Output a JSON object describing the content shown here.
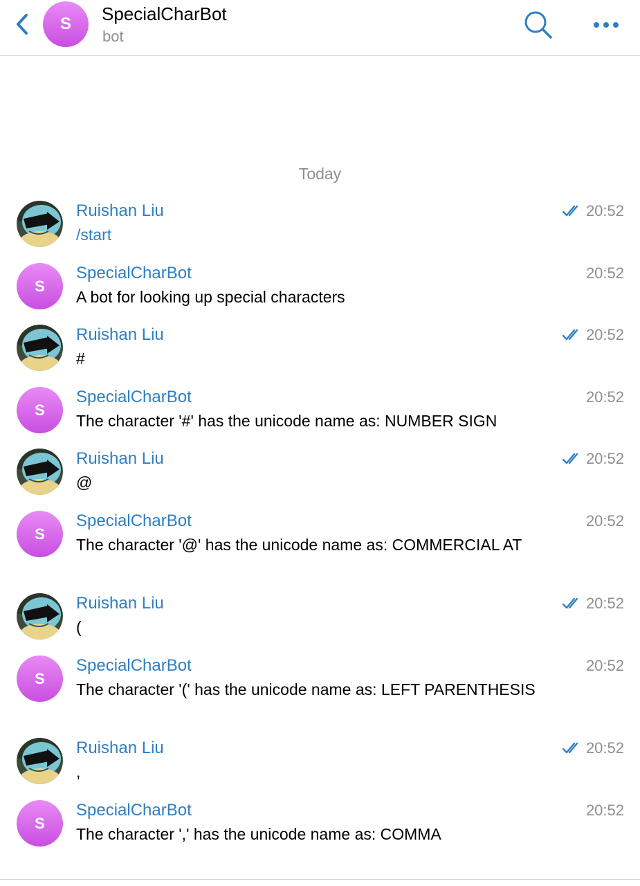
{
  "header": {
    "avatar_letter": "S",
    "title": "SpecialCharBot",
    "subtitle": "bot"
  },
  "date_separator": "Today",
  "messages": [
    {
      "sender": "Ruishan Liu",
      "text": "/start",
      "time": "20:52"
    },
    {
      "sender": "SpecialCharBot",
      "avatar_letter": "S",
      "text": "A bot for looking up special characters",
      "time": "20:52"
    },
    {
      "sender": "Ruishan Liu",
      "text": "#",
      "time": "20:52"
    },
    {
      "sender": "SpecialCharBot",
      "avatar_letter": "S",
      "text": "The character '#' has the unicode name as: NUMBER SIGN",
      "time": "20:52"
    },
    {
      "sender": "Ruishan Liu",
      "text": "@",
      "time": "20:52"
    },
    {
      "sender": "SpecialCharBot",
      "avatar_letter": "S",
      "text": "The character '@' has the unicode name as: COMMERCIAL AT",
      "time": "20:52"
    },
    {
      "sender": "Ruishan Liu",
      "text": "(",
      "time": "20:52"
    },
    {
      "sender": "SpecialCharBot",
      "avatar_letter": "S",
      "text": "The character '(' has the unicode name as: LEFT PARENTHESIS",
      "time": "20:52"
    },
    {
      "sender": "Ruishan Liu",
      "text": ",",
      "time": "20:52"
    },
    {
      "sender": "SpecialCharBot",
      "avatar_letter": "S",
      "text": "The character ',' has the unicode name as: COMMA",
      "time": "20:52"
    }
  ],
  "colors": {
    "accent": "#2f7fc1",
    "bot_avatar_top": "#e98af6",
    "bot_avatar_bottom": "#c84fe0",
    "muted": "#8e8e93"
  }
}
